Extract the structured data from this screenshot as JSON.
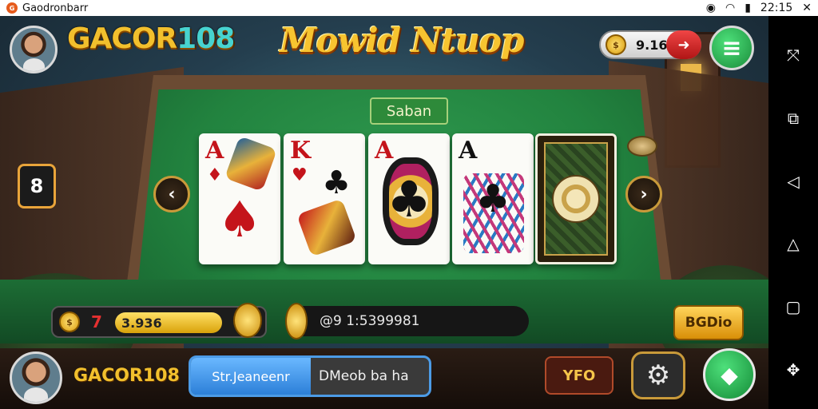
{
  "status_bar": {
    "app_name": "Gaodronbarr",
    "time": "22:15"
  },
  "header": {
    "brand_prefix": "GACOR",
    "brand_suffix": "108",
    "title": "Mowid Ntuop",
    "coins_value": "9.16"
  },
  "table": {
    "label": "Saban",
    "side_badge": "8"
  },
  "cards": [
    {
      "rank": "A",
      "suit": "♠",
      "color": "red"
    },
    {
      "rank": "K",
      "suit": "♣",
      "color": "red"
    },
    {
      "rank": "A",
      "suit": "♣",
      "color": "red"
    },
    {
      "rank": "A",
      "suit": "♣",
      "color": "black"
    },
    {
      "rank": "",
      "suit": "",
      "color": "back"
    }
  ],
  "bet": {
    "number": "7",
    "amount": "3.936"
  },
  "info": {
    "text": "@9 1:5399981"
  },
  "action_button": "BGDio",
  "player": {
    "name": "GACOR108"
  },
  "chat": {
    "left": "Str.Jeaneenr",
    "right": "DMeob ba ha"
  },
  "level_button": "YFO",
  "icons": {
    "wifi": "wifi-icon",
    "signal": "signal-icon",
    "close": "close-icon",
    "menu": "menu-icon",
    "gear": "gear-icon",
    "go": "play-icon"
  },
  "colors": {
    "felt": "#22833f",
    "gold": "#f2c02d",
    "accent_blue": "#4c9be6",
    "danger": "#e03030"
  }
}
